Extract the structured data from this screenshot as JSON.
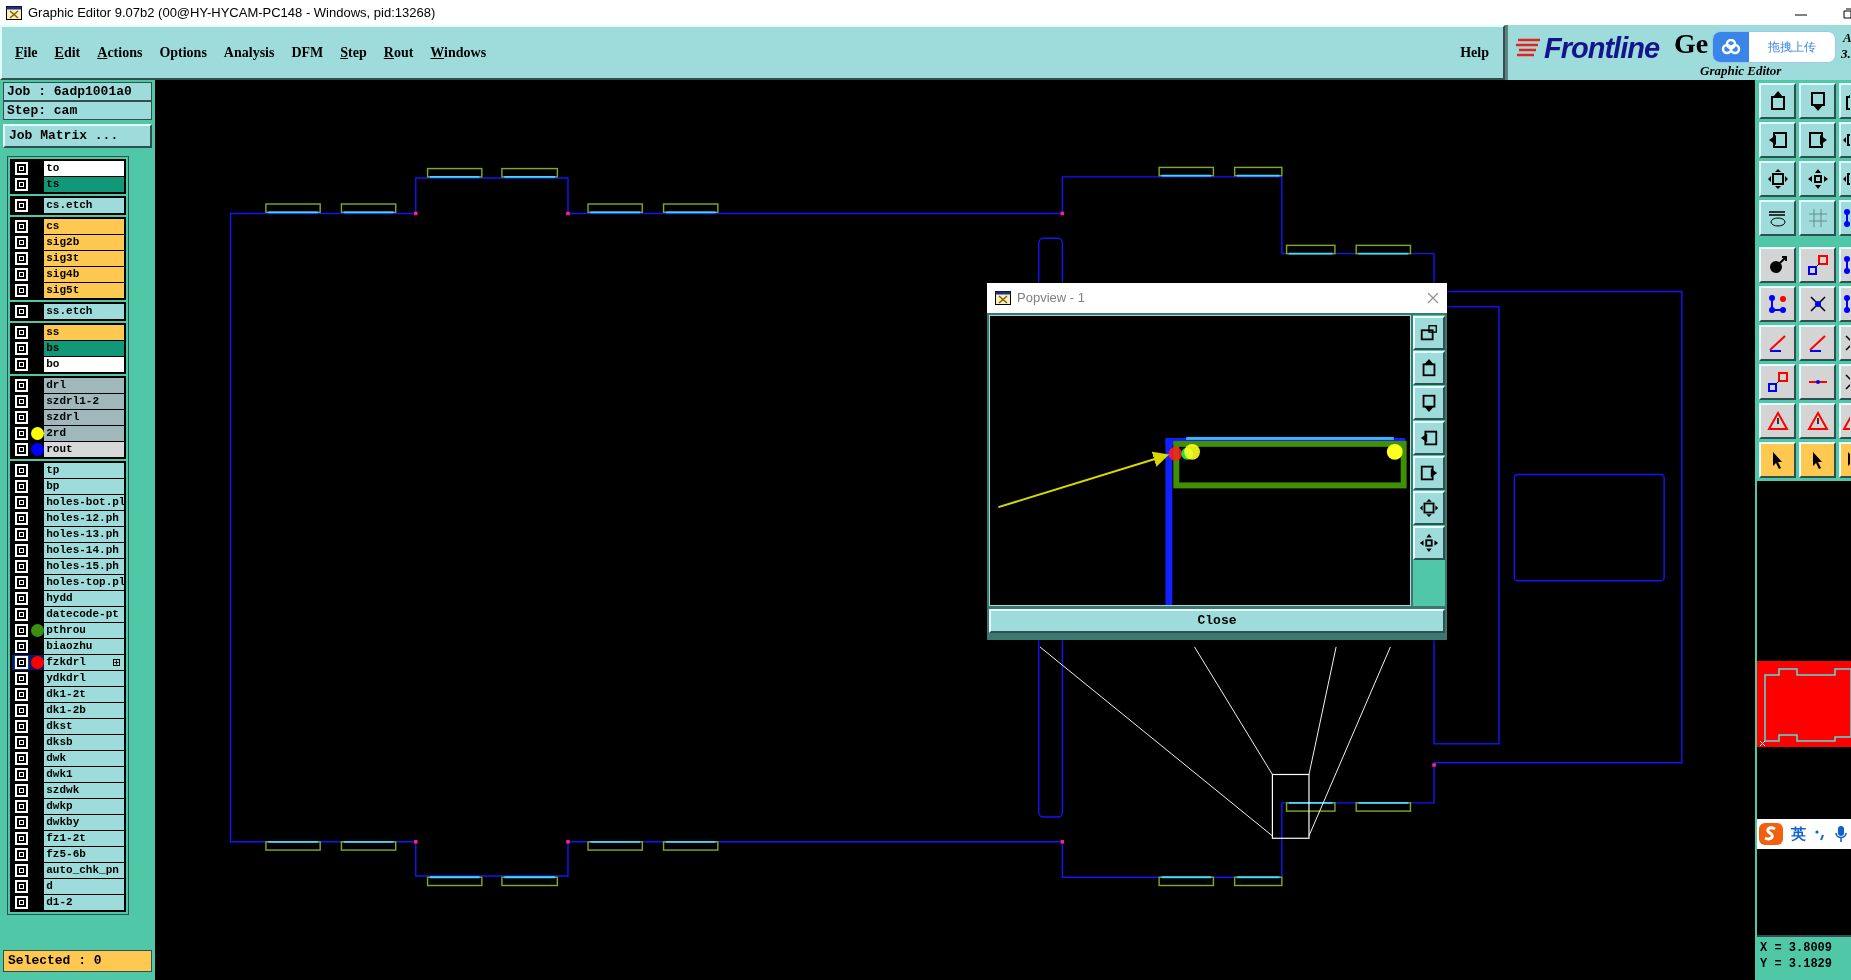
{
  "window": {
    "title": "Graphic Editor 9.07b2 (00@HY-HYCAM-PC148 - Windows, pid:13268)"
  },
  "menu": [
    {
      "label": "File",
      "mnemonic": true
    },
    {
      "label": "Edit",
      "mnemonic": true
    },
    {
      "label": "Actions",
      "mnemonic": true
    },
    {
      "label": "Options",
      "mnemonic": false
    },
    {
      "label": "Analysis",
      "mnemonic": false
    },
    {
      "label": "DFM",
      "mnemonic": false
    },
    {
      "label": "Step",
      "mnemonic": true
    },
    {
      "label": "Rout",
      "mnemonic": true
    },
    {
      "label": "Windows",
      "mnemonic": true
    }
  ],
  "help": "Help",
  "logo": {
    "brand": "Frontline",
    "product": "Ge",
    "subtitle": "Graphic Editor",
    "fragment_1": "A",
    "fragment_2": "3."
  },
  "upload_widget": {
    "label": "拖拽上传"
  },
  "job_panel": {
    "job": "Job : 6adp1001a0",
    "step": "Step: cam",
    "matrix_button": "Job Matrix ..."
  },
  "layer_groups": [
    {
      "layers": [
        {
          "name": "to",
          "kind": "silkscreen",
          "selected": false,
          "expandable": false
        },
        {
          "name": "ts",
          "kind": "soldermask",
          "selected": false,
          "expandable": false
        }
      ]
    },
    {
      "layers": [
        {
          "name": "cs.etch",
          "kind": "document",
          "selected": false,
          "expandable": false
        }
      ]
    },
    {
      "layers": [
        {
          "name": "cs",
          "kind": "signal",
          "selected": false,
          "expandable": false
        },
        {
          "name": "sig2b",
          "kind": "signal",
          "selected": false,
          "expandable": false
        },
        {
          "name": "sig3t",
          "kind": "signal",
          "selected": false,
          "expandable": false
        },
        {
          "name": "sig4b",
          "kind": "signal",
          "selected": false,
          "expandable": false
        },
        {
          "name": "sig5t",
          "kind": "signal",
          "selected": false,
          "expandable": false
        }
      ]
    },
    {
      "layers": [
        {
          "name": "ss.etch",
          "kind": "document",
          "selected": false,
          "expandable": false
        }
      ]
    },
    {
      "layers": [
        {
          "name": "ss",
          "kind": "signal",
          "selected": false,
          "expandable": false
        },
        {
          "name": "bs",
          "kind": "soldermask",
          "selected": false,
          "expandable": false
        },
        {
          "name": "bo",
          "kind": "silkscreen",
          "selected": false,
          "expandable": false
        }
      ]
    },
    {
      "layers": [
        {
          "name": "drl",
          "kind": "drill",
          "selected": false,
          "expandable": false
        },
        {
          "name": "szdrl1-2",
          "kind": "drill",
          "selected": false,
          "expandable": false
        },
        {
          "name": "szdrl",
          "kind": "drill",
          "selected": false,
          "expandable": false
        },
        {
          "name": "2rd",
          "kind": "drill",
          "color": "#ffff00",
          "selected": false,
          "expandable": false
        },
        {
          "name": "rout",
          "kind": "rout",
          "color": "#0000ff",
          "selected": false,
          "expandable": false
        }
      ]
    },
    {
      "layers": [
        {
          "name": "tp",
          "kind": "document",
          "selected": false,
          "expandable": false
        },
        {
          "name": "bp",
          "kind": "document",
          "selected": false,
          "expandable": false
        },
        {
          "name": "holes-bot.pl",
          "kind": "document",
          "selected": false,
          "expandable": false
        },
        {
          "name": "holes-12.ph",
          "kind": "document",
          "selected": false,
          "expandable": false
        },
        {
          "name": "holes-13.ph",
          "kind": "document",
          "selected": false,
          "expandable": false
        },
        {
          "name": "holes-14.ph",
          "kind": "document",
          "selected": false,
          "expandable": false
        },
        {
          "name": "holes-15.ph",
          "kind": "document",
          "selected": false,
          "expandable": false
        },
        {
          "name": "holes-top.pl",
          "kind": "document",
          "selected": false,
          "expandable": false
        },
        {
          "name": "hydd",
          "kind": "document",
          "selected": false,
          "expandable": false
        },
        {
          "name": "datecode-pt",
          "kind": "document",
          "selected": false,
          "expandable": false
        },
        {
          "name": "pthrou",
          "kind": "document",
          "color": "#3c9010",
          "selected": false,
          "expandable": false
        },
        {
          "name": "biaozhu",
          "kind": "document",
          "selected": false,
          "expandable": false
        },
        {
          "name": "fzkdrl",
          "kind": "document",
          "color": "#ff0000",
          "selected": true,
          "expandable": true
        },
        {
          "name": "ydkdrl",
          "kind": "document",
          "selected": false,
          "expandable": false
        },
        {
          "name": "dk1-2t",
          "kind": "document",
          "selected": false,
          "expandable": false
        },
        {
          "name": "dk1-2b",
          "kind": "document",
          "selected": false,
          "expandable": false
        },
        {
          "name": "dkst",
          "kind": "document",
          "selected": false,
          "expandable": false
        },
        {
          "name": "dksb",
          "kind": "document",
          "selected": false,
          "expandable": false
        },
        {
          "name": "dwk",
          "kind": "document",
          "selected": false,
          "expandable": false
        },
        {
          "name": "dwk1",
          "kind": "document",
          "selected": false,
          "expandable": false
        },
        {
          "name": "szdwk",
          "kind": "document",
          "selected": false,
          "expandable": false
        },
        {
          "name": "dwkp",
          "kind": "document",
          "selected": false,
          "expandable": false
        },
        {
          "name": "dwkby",
          "kind": "document",
          "selected": false,
          "expandable": false
        },
        {
          "name": "fz1-2t",
          "kind": "document",
          "selected": false,
          "expandable": false
        },
        {
          "name": "fz5-6b",
          "kind": "document",
          "selected": false,
          "expandable": false
        },
        {
          "name": "auto_chk_pn",
          "kind": "document",
          "selected": false,
          "expandable": false
        },
        {
          "name": "d",
          "kind": "document",
          "selected": false,
          "expandable": false
        },
        {
          "name": "d1-2",
          "kind": "document",
          "selected": false,
          "expandable": false
        }
      ]
    }
  ],
  "selected_status": "Selected : 0",
  "popview": {
    "title": "Popview - 1",
    "close_button": "Close"
  },
  "ime_bar": {
    "language": "英"
  },
  "coordinates": {
    "x": "X = 3.8009",
    "y": "Y = 3.1829"
  }
}
